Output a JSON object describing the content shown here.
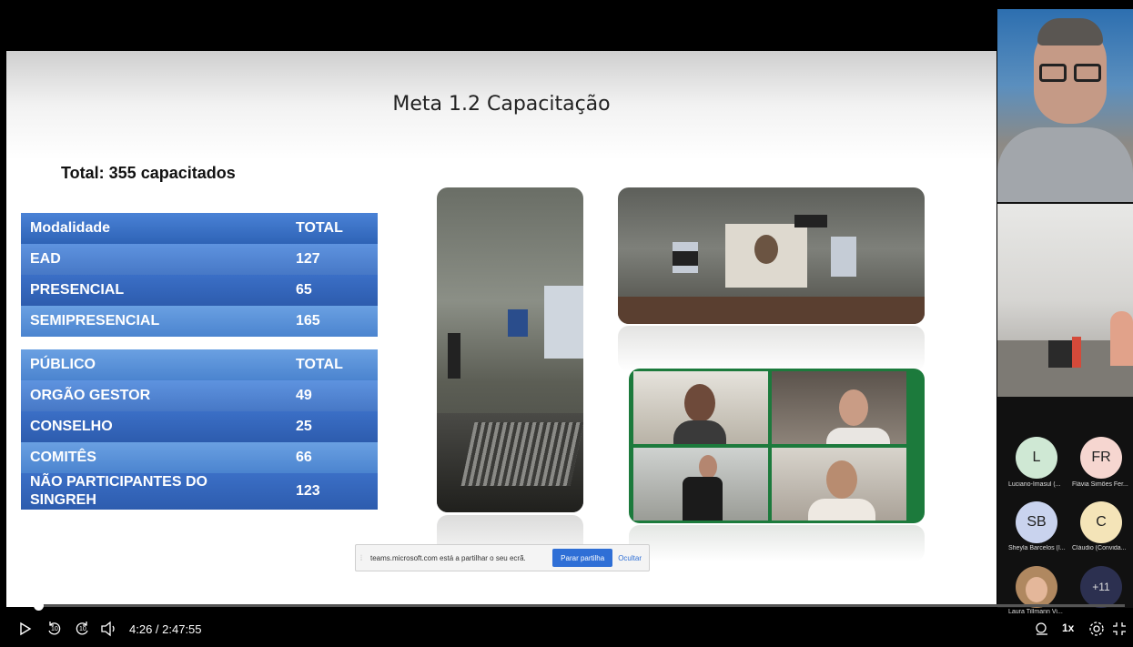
{
  "slide": {
    "title": "Meta 1.2 Capacitação",
    "total": "Total: 355 capacitados",
    "table1": {
      "header": [
        "Modalidade",
        "TOTAL"
      ],
      "rows": [
        [
          "EAD",
          "127"
        ],
        [
          "PRESENCIAL",
          "65"
        ],
        [
          "SEMIPRESENCIAL",
          "165"
        ]
      ]
    },
    "table2": {
      "header": [
        "PÚBLICO",
        "TOTAL"
      ],
      "rows": [
        [
          "ORGÃO GESTOR",
          "49"
        ],
        [
          "CONSELHO",
          "25"
        ],
        [
          "COMITÊS",
          "66"
        ],
        [
          "NÃO PARTICIPANTES DO SINGREH",
          "123"
        ]
      ]
    }
  },
  "share_bar": {
    "message": "teams.microsoft.com está a partilhar o seu ecrã.",
    "stop_label": "Parar partilha",
    "hide_label": "Ocultar"
  },
  "participants": [
    {
      "initials": "L",
      "name": "Luciano-Imasul (...",
      "color": "#cfe8d4"
    },
    {
      "initials": "FR",
      "name": "Flávia Simões Fer...",
      "color": "#f6d6d0"
    },
    {
      "initials": "SB",
      "name": "Sheyla Barcelos (I...",
      "color": "#c9d3ee"
    },
    {
      "initials": "C",
      "name": "Cláudio (Convida...",
      "color": "#f4e4b8"
    },
    {
      "initials": "",
      "name": "Laura Tillmann Vi...",
      "color": "#b08860"
    },
    {
      "initials": "+11",
      "name": "",
      "color": "#2c3050"
    }
  ],
  "player": {
    "time": "4:26 / 2:47:55",
    "speed": "1x",
    "progress": 0.026,
    "rewind_seconds": "10",
    "forward_seconds": "10"
  }
}
